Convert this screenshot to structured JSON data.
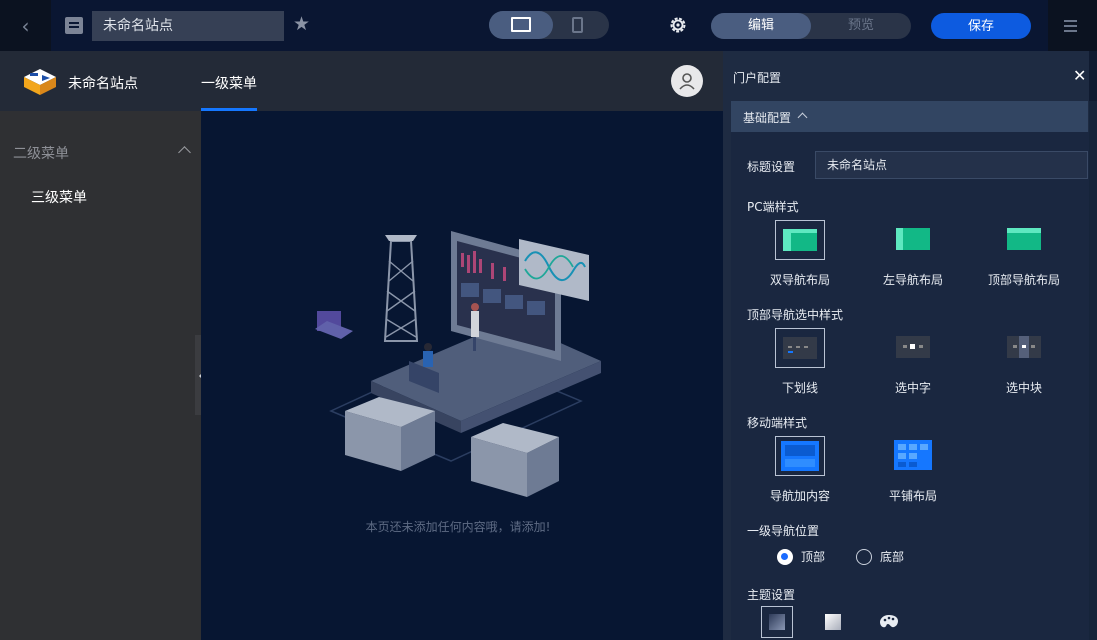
{
  "toolbar": {
    "site_title_value": "未命名站点",
    "edit_label": "编辑",
    "preview_label": "预览",
    "save_label": "保存"
  },
  "site": {
    "name": "未命名站点",
    "top_nav": [
      "一级菜单"
    ],
    "side_nav": {
      "level2": "二级菜单",
      "level3": "三级菜单"
    },
    "empty_text": "本页还未添加任何内容哦，请添加!"
  },
  "panel": {
    "title": "门户配置",
    "section": "基础配置",
    "title_setting_label": "标题设置",
    "title_setting_value": "未命名站点",
    "pc_style_label": "PC端样式",
    "pc_styles": [
      "双导航布局",
      "左导航布局",
      "顶部导航布局"
    ],
    "top_nav_sel_label": "顶部导航选中样式",
    "top_nav_sel_styles": [
      "下划线",
      "选中字",
      "选中块"
    ],
    "mobile_style_label": "移动端样式",
    "mobile_styles": [
      "导航加内容",
      "平铺布局"
    ],
    "nav_position_label": "一级导航位置",
    "nav_positions": [
      "顶部",
      "底部"
    ],
    "nav_position_selected": "顶部",
    "theme_label": "主题设置"
  },
  "colors": {
    "accent": "#1577ff",
    "save": "#0d5be0",
    "thumb_green": "#12b886"
  }
}
